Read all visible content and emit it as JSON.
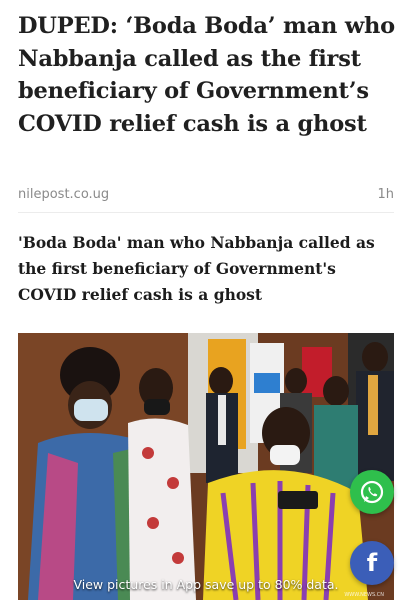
{
  "article": {
    "headline": "DUPED: ‘Boda Boda’ man who Nabbanja called as the first beneficiary of Government’s COVID relief cash is a ghost",
    "source": "nilepost.co.ug",
    "time_ago": "1h",
    "subheadline": "'Boda Boda' man who Nabbanja called as the first beneficiary of Government's COVID relief cash is a ghost"
  },
  "photo": {
    "caption": "View pictures in App save up to 80% data.",
    "watermark": "WWW.NEWS.CN"
  },
  "share": {
    "whatsapp_icon": "whatsapp-icon",
    "facebook_icon": "facebook-icon",
    "whatsapp_color": "#2fbf4c",
    "facebook_color": "#3b5eb8"
  }
}
